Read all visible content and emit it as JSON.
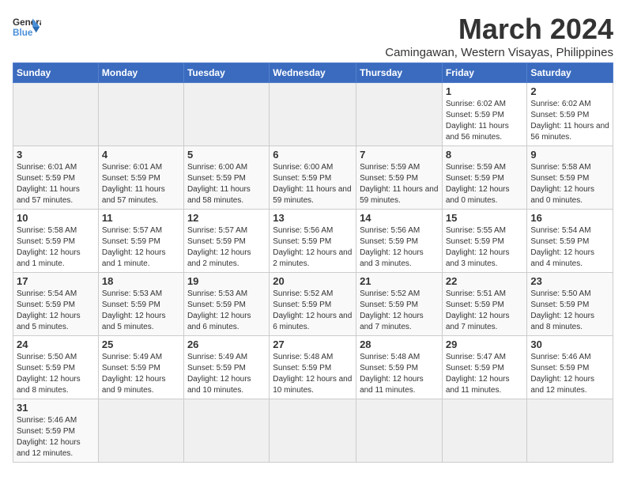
{
  "header": {
    "logo_general": "General",
    "logo_blue": "Blue",
    "month_year": "March 2024",
    "location": "Camingawan, Western Visayas, Philippines"
  },
  "weekdays": [
    "Sunday",
    "Monday",
    "Tuesday",
    "Wednesday",
    "Thursday",
    "Friday",
    "Saturday"
  ],
  "weeks": [
    {
      "days": [
        {
          "num": "",
          "info": ""
        },
        {
          "num": "",
          "info": ""
        },
        {
          "num": "",
          "info": ""
        },
        {
          "num": "",
          "info": ""
        },
        {
          "num": "",
          "info": ""
        },
        {
          "num": "1",
          "info": "Sunrise: 6:02 AM\nSunset: 5:59 PM\nDaylight: 11 hours and 56 minutes."
        },
        {
          "num": "2",
          "info": "Sunrise: 6:02 AM\nSunset: 5:59 PM\nDaylight: 11 hours and 56 minutes."
        }
      ]
    },
    {
      "days": [
        {
          "num": "3",
          "info": "Sunrise: 6:01 AM\nSunset: 5:59 PM\nDaylight: 11 hours and 57 minutes."
        },
        {
          "num": "4",
          "info": "Sunrise: 6:01 AM\nSunset: 5:59 PM\nDaylight: 11 hours and 57 minutes."
        },
        {
          "num": "5",
          "info": "Sunrise: 6:00 AM\nSunset: 5:59 PM\nDaylight: 11 hours and 58 minutes."
        },
        {
          "num": "6",
          "info": "Sunrise: 6:00 AM\nSunset: 5:59 PM\nDaylight: 11 hours and 59 minutes."
        },
        {
          "num": "7",
          "info": "Sunrise: 5:59 AM\nSunset: 5:59 PM\nDaylight: 11 hours and 59 minutes."
        },
        {
          "num": "8",
          "info": "Sunrise: 5:59 AM\nSunset: 5:59 PM\nDaylight: 12 hours and 0 minutes."
        },
        {
          "num": "9",
          "info": "Sunrise: 5:58 AM\nSunset: 5:59 PM\nDaylight: 12 hours and 0 minutes."
        }
      ]
    },
    {
      "days": [
        {
          "num": "10",
          "info": "Sunrise: 5:58 AM\nSunset: 5:59 PM\nDaylight: 12 hours and 1 minute."
        },
        {
          "num": "11",
          "info": "Sunrise: 5:57 AM\nSunset: 5:59 PM\nDaylight: 12 hours and 1 minute."
        },
        {
          "num": "12",
          "info": "Sunrise: 5:57 AM\nSunset: 5:59 PM\nDaylight: 12 hours and 2 minutes."
        },
        {
          "num": "13",
          "info": "Sunrise: 5:56 AM\nSunset: 5:59 PM\nDaylight: 12 hours and 2 minutes."
        },
        {
          "num": "14",
          "info": "Sunrise: 5:56 AM\nSunset: 5:59 PM\nDaylight: 12 hours and 3 minutes."
        },
        {
          "num": "15",
          "info": "Sunrise: 5:55 AM\nSunset: 5:59 PM\nDaylight: 12 hours and 3 minutes."
        },
        {
          "num": "16",
          "info": "Sunrise: 5:54 AM\nSunset: 5:59 PM\nDaylight: 12 hours and 4 minutes."
        }
      ]
    },
    {
      "days": [
        {
          "num": "17",
          "info": "Sunrise: 5:54 AM\nSunset: 5:59 PM\nDaylight: 12 hours and 5 minutes."
        },
        {
          "num": "18",
          "info": "Sunrise: 5:53 AM\nSunset: 5:59 PM\nDaylight: 12 hours and 5 minutes."
        },
        {
          "num": "19",
          "info": "Sunrise: 5:53 AM\nSunset: 5:59 PM\nDaylight: 12 hours and 6 minutes."
        },
        {
          "num": "20",
          "info": "Sunrise: 5:52 AM\nSunset: 5:59 PM\nDaylight: 12 hours and 6 minutes."
        },
        {
          "num": "21",
          "info": "Sunrise: 5:52 AM\nSunset: 5:59 PM\nDaylight: 12 hours and 7 minutes."
        },
        {
          "num": "22",
          "info": "Sunrise: 5:51 AM\nSunset: 5:59 PM\nDaylight: 12 hours and 7 minutes."
        },
        {
          "num": "23",
          "info": "Sunrise: 5:50 AM\nSunset: 5:59 PM\nDaylight: 12 hours and 8 minutes."
        }
      ]
    },
    {
      "days": [
        {
          "num": "24",
          "info": "Sunrise: 5:50 AM\nSunset: 5:59 PM\nDaylight: 12 hours and 8 minutes."
        },
        {
          "num": "25",
          "info": "Sunrise: 5:49 AM\nSunset: 5:59 PM\nDaylight: 12 hours and 9 minutes."
        },
        {
          "num": "26",
          "info": "Sunrise: 5:49 AM\nSunset: 5:59 PM\nDaylight: 12 hours and 10 minutes."
        },
        {
          "num": "27",
          "info": "Sunrise: 5:48 AM\nSunset: 5:59 PM\nDaylight: 12 hours and 10 minutes."
        },
        {
          "num": "28",
          "info": "Sunrise: 5:48 AM\nSunset: 5:59 PM\nDaylight: 12 hours and 11 minutes."
        },
        {
          "num": "29",
          "info": "Sunrise: 5:47 AM\nSunset: 5:59 PM\nDaylight: 12 hours and 11 minutes."
        },
        {
          "num": "30",
          "info": "Sunrise: 5:46 AM\nSunset: 5:59 PM\nDaylight: 12 hours and 12 minutes."
        }
      ]
    },
    {
      "days": [
        {
          "num": "31",
          "info": "Sunrise: 5:46 AM\nSunset: 5:59 PM\nDaylight: 12 hours and 12 minutes."
        },
        {
          "num": "",
          "info": ""
        },
        {
          "num": "",
          "info": ""
        },
        {
          "num": "",
          "info": ""
        },
        {
          "num": "",
          "info": ""
        },
        {
          "num": "",
          "info": ""
        },
        {
          "num": "",
          "info": ""
        }
      ]
    }
  ]
}
